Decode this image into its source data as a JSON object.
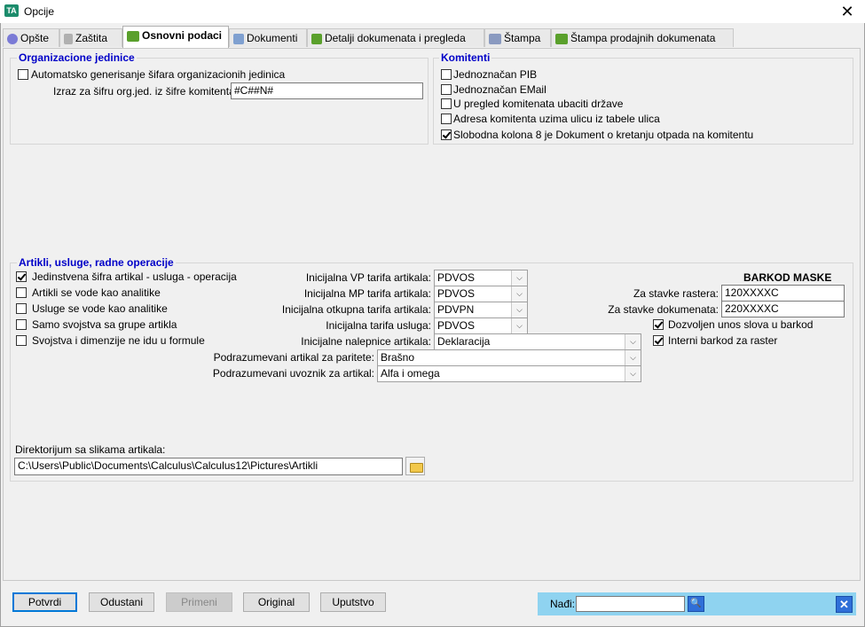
{
  "window": {
    "title": "Opcije",
    "close_glyph": "✕",
    "app_icon_text": "TA"
  },
  "tabs": [
    {
      "label": "Opšte",
      "icon": "gear-icon",
      "color": "#7b7bd6"
    },
    {
      "label": "Zaštita",
      "icon": "lock-icon",
      "color": "#b0b0b0"
    },
    {
      "label": "Osnovni podaci",
      "icon": "folder-data-icon",
      "color": "#5aa02c"
    },
    {
      "label": "Dokumenti",
      "icon": "document-icon",
      "color": "#7fa0d0"
    },
    {
      "label": "Detalji dokumenata i pregleda",
      "icon": "document-details-icon",
      "color": "#5aa02c"
    },
    {
      "label": "Štampa",
      "icon": "printer-icon",
      "color": "#8a9ac0"
    },
    {
      "label": "Štampa prodajnih dokumenata",
      "icon": "printer-green-icon",
      "color": "#5aa02c"
    }
  ],
  "org": {
    "title": "Organizacione jedinice",
    "auto_gen_label": "Automatsko generisanje šifara organizacionih jedinica",
    "auto_gen_checked": false,
    "izraz_label": "Izraz za šifru org.jed. iz šifre komitenta:",
    "izraz_value": "#C##N#"
  },
  "komitenti": {
    "title": "Komitenti",
    "items": [
      {
        "label": "Jednoznačan PIB",
        "checked": false
      },
      {
        "label": "Jednoznačan EMail",
        "checked": false
      },
      {
        "label": "U pregled komitenata ubaciti države",
        "checked": false
      },
      {
        "label": "Adresa komitenta uzima ulicu iz tabele ulica",
        "checked": false
      },
      {
        "label": "Slobodna kolona 8 je Dokument o kretanju otpada na komitentu",
        "checked": true
      }
    ]
  },
  "artikli": {
    "title": "Artikli, usluge, radne operacije",
    "checks": [
      {
        "label": "Jedinstvena šifra artikal - usluga - operacija",
        "checked": true
      },
      {
        "label": "Artikli se vode kao analitike",
        "checked": false
      },
      {
        "label": "Usluge se vode kao analitike",
        "checked": false
      },
      {
        "label": "Samo svojstva sa grupe artikla",
        "checked": false
      },
      {
        "label": "Svojstva i dimenzije ne idu u formule",
        "checked": false
      }
    ],
    "vp_label": "Inicijalna VP tarifa artikala:",
    "vp_value": "PDVOS",
    "mp_label": "Inicijalna MP tarifa artikala:",
    "mp_value": "PDVOS",
    "otkupna_label": "Inicijalna otkupna tarifa artikala:",
    "otkupna_value": "PDVPN",
    "usluga_label": "Inicijalna tarifa usluga:",
    "usluga_value": "PDVOS",
    "nalepnice_label": "Inicijalne nalepnice artikala:",
    "nalepnice_value": "Deklaracija",
    "paritete_label": "Podrazumevani artikal za paritete:",
    "paritete_value": "Brašno",
    "uvoznik_label": "Podrazumevani uvoznik za artikal:",
    "uvoznik_value": "Alfa i omega",
    "barkod_title": "BARKOD MASKE",
    "rastera_label": "Za stavke rastera:",
    "rastera_value": "120XXXXC",
    "dokumenata_label": "Za stavke dokumenata:",
    "dokumenata_value": "220XXXXC",
    "slova_label": "Dozvoljen unos slova u barkod",
    "slova_checked": true,
    "interni_label": "Interni barkod za raster",
    "interni_checked": true,
    "dir_label": "Direktorijum sa slikama artikala:",
    "dir_value": "C:\\Users\\Public\\Documents\\Calculus\\Calculus12\\Pictures\\Artikli"
  },
  "buttons": {
    "potvrdi": "Potvrdi",
    "odustani": "Odustani",
    "primeni": "Primeni",
    "original": "Original",
    "uputstvo": "Uputstvo"
  },
  "find": {
    "label": "Nađi:",
    "value": ""
  },
  "glyphs": {
    "combo_arrow": "⌵",
    "search": "🔍",
    "clear": "✕"
  }
}
